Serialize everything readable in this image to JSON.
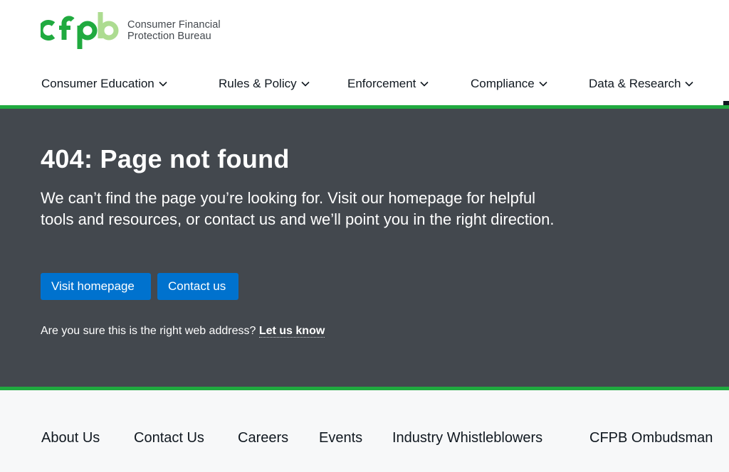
{
  "header": {
    "logo": {
      "mark_text": "cfpb",
      "line1": "Consumer Financial",
      "line2": "Protection Bureau",
      "colors": {
        "dark_green": "#20aa3f",
        "light_green": "#addc91"
      }
    },
    "nav": [
      {
        "label": "Consumer Education",
        "icon": "chevron-down-icon"
      },
      {
        "label": "Rules & Policy",
        "icon": "chevron-down-icon"
      },
      {
        "label": "Enforcement",
        "icon": "chevron-down-icon"
      },
      {
        "label": "Compliance",
        "icon": "chevron-down-icon"
      },
      {
        "label": "Data & Research",
        "icon": "chevron-down-icon"
      }
    ]
  },
  "hero": {
    "title": "404: Page not found",
    "lead": "We can’t find the page you’re looking for. Visit our homepage for helpful tools and resources, or contact us and we’ll point you in the right direction.",
    "buttons": {
      "home": "Visit homepage",
      "contact": "Contact us"
    },
    "hint_text": "Are you sure this is the right web address?",
    "hint_link": "Let us know"
  },
  "footer": {
    "links": [
      "About Us",
      "Contact Us",
      "Careers",
      "Events",
      "Industry Whistleblowers",
      "CFPB Ombudsman"
    ]
  },
  "colors": {
    "accent_green": "#20aa3f",
    "hero_bg": "#43484e",
    "button_blue": "#0072ce",
    "footer_bg": "#f7f8f9",
    "text_dark": "#101820"
  }
}
